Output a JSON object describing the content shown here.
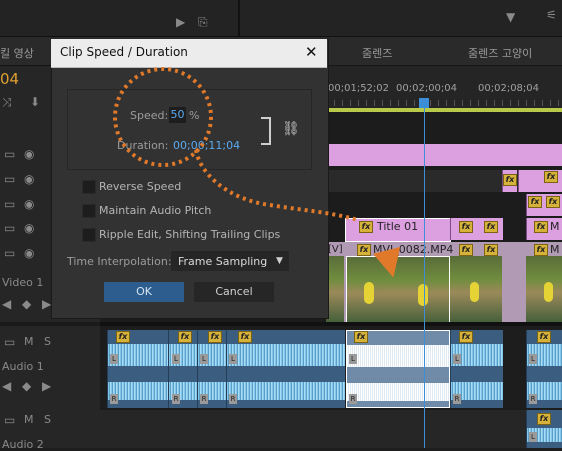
{
  "header": {
    "tabs": [
      "킬 영상",
      "줌렌즈",
      "줌렌즈 고양이"
    ]
  },
  "timeline": {
    "timecode": "04",
    "ruler": [
      "00;01;52;02",
      "00;02;00;04",
      "00;02;08;04"
    ],
    "tracks": {
      "video_track_label": "Video 1",
      "audio_track_label": "Audio 1",
      "audio2_track_label": "Audio 2",
      "mute_label": "M",
      "solo_label": "S"
    },
    "clips": {
      "title_clip": "Title 01",
      "video_clip": "MVI_0082.MP4",
      "v_badge": "[V]",
      "fx_badge": "fx",
      "left_badge": "L",
      "right_badge": "R"
    }
  },
  "dialog": {
    "title": "Clip Speed / Duration",
    "speed_label": "Speed:",
    "speed_value": "50",
    "speed_unit": "%",
    "duration_label": "Duration:",
    "duration_value": "00;00;11;04",
    "options": [
      {
        "label": "Reverse Speed",
        "checked": false
      },
      {
        "label": "Maintain Audio Pitch",
        "checked": false
      },
      {
        "label": "Ripple Edit, Shifting Trailing Clips",
        "checked": false
      }
    ],
    "interpolation_label": "Time Interpolation:",
    "interpolation_value": "Frame Sampling",
    "ok_label": "OK",
    "cancel_label": "Cancel"
  },
  "colors": {
    "video_clip": "#dc9fe0",
    "audio_clip": "#3a5d80",
    "fx_badge": "#d6b23a",
    "annotation": "#e07a2a",
    "playhead": "#3c8fd6",
    "accent_blue": "#2d5fa0"
  }
}
